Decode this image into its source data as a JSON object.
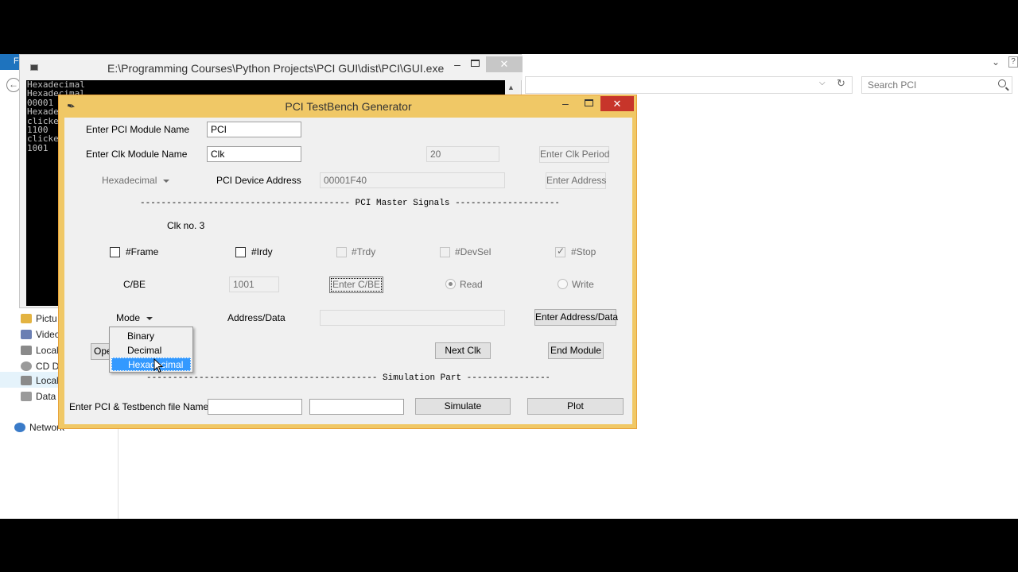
{
  "explorer": {
    "file_tab": "F",
    "back_glyph": "←",
    "search_placeholder": "Search PCI",
    "nav_items": [
      {
        "label": "Pictu",
        "color": "#e3b341"
      },
      {
        "label": "Video",
        "color": "#6b7fb3"
      },
      {
        "label": "Local",
        "color": "#8a8a8a"
      },
      {
        "label": "CD D",
        "color": "#9a9a9a"
      },
      {
        "label": "Local",
        "color": "#8a8a8a"
      },
      {
        "label": "Data",
        "color": "#9a9a9a"
      }
    ],
    "network_label": "Network"
  },
  "console": {
    "title": "E:\\Programming Courses\\Python Projects\\PCI GUI\\dist\\PCI\\GUI.exe",
    "close_glyph": "✕",
    "lines": [
      "Hexadecimal",
      "Hexadecimal",
      "00001",
      "Hexade",
      "clicke",
      "1100",
      "clicke",
      "1001"
    ]
  },
  "window": {
    "title": "PCI TestBench Generator",
    "close_glyph": "✕",
    "min_glyph": "–"
  },
  "form": {
    "module_name_label": "Enter PCI Module Name",
    "module_name_value": "PCI",
    "clk_name_label": "Enter Clk Module Name",
    "clk_name_value": "Clk",
    "clk_period_value": "20",
    "clk_period_button": "Enter Clk Period",
    "base_select": "Hexadecimal",
    "device_address_label": "PCI Device Address",
    "device_address_value": "00001F40",
    "enter_address_button": "Enter Address",
    "master_signals_sep": "---------------------------------------- PCI Master Signals ---------------------------------------------",
    "clk_no_label": "Clk no. 3",
    "signals": {
      "frame": "#Frame",
      "irdy": "#Irdy",
      "trdy": "#Trdy",
      "devsel": "#DevSel",
      "stop": "#Stop"
    },
    "cbe_label": "C/BE",
    "cbe_value": "1001",
    "cbe_button": "Enter C/BE",
    "read_label": "Read",
    "write_label": "Write",
    "mode_label": "Mode",
    "address_data_label": "Address/Data",
    "address_data_value": "",
    "address_data_button": "Enter Address/Data",
    "open_button": "Ope",
    "next_clk_button": "Next Clk",
    "end_module_button": "End Module",
    "simulation_sep": "-------------------------------------------- Simulation Part -------------------------------------------",
    "file_name_label": "Enter PCI & Testbench file Name",
    "file_name_value_1": "",
    "file_name_value_2": "",
    "simulate_button": "Simulate",
    "plot_button": "Plot"
  },
  "mode_menu": {
    "options": [
      "Binary",
      "Decimal",
      "Hexadecimal"
    ],
    "selected": "Hexadecimal"
  }
}
